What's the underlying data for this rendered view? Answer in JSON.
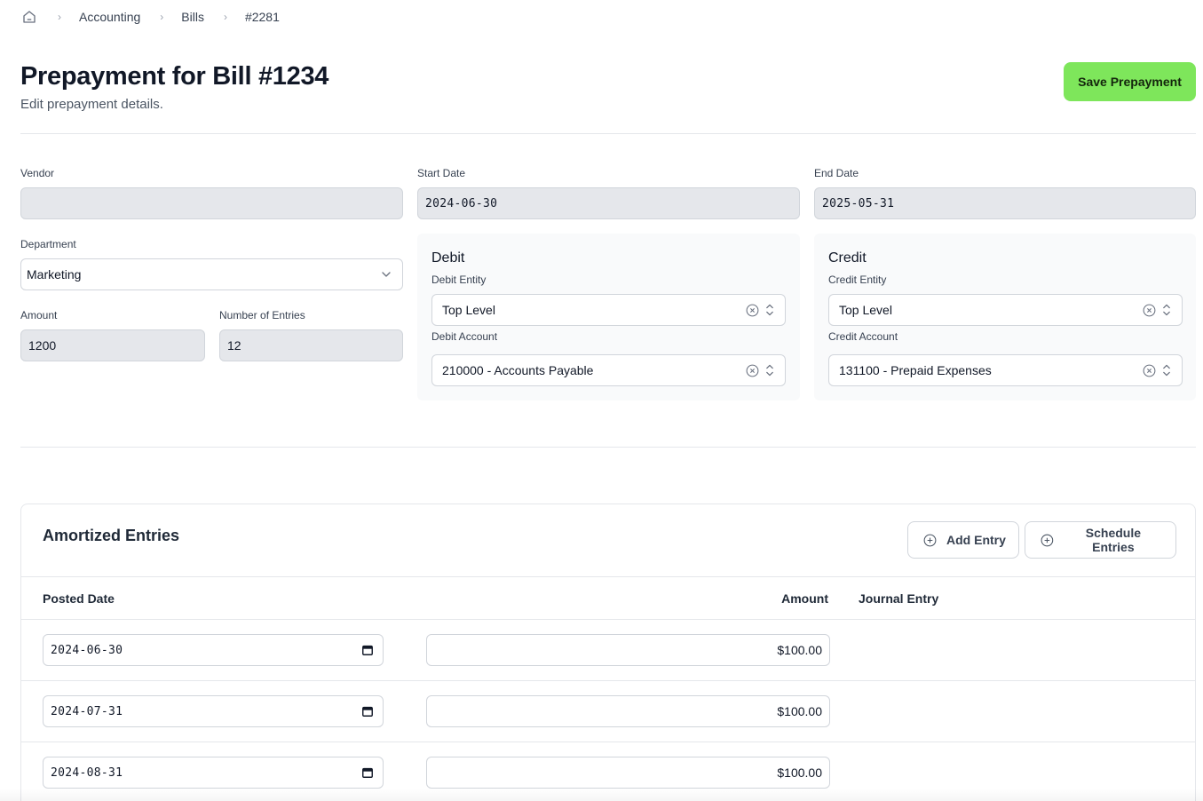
{
  "breadcrumb": {
    "items": [
      "Accounting",
      "Bills",
      "#2281"
    ]
  },
  "header": {
    "title": "Prepayment for Bill #1234",
    "subtitle": "Edit prepayment details.",
    "save_label": "Save Prepayment"
  },
  "form": {
    "vendor": {
      "label": "Vendor",
      "value": ""
    },
    "start_date": {
      "label": "Start Date",
      "value": "2024-06-30"
    },
    "end_date": {
      "label": "End Date",
      "value": "2025-05-31"
    },
    "department": {
      "label": "Department",
      "value": "Marketing"
    },
    "amount": {
      "label": "Amount",
      "value": "1200"
    },
    "number_of_entries": {
      "label": "Number of Entries",
      "value": "12"
    }
  },
  "debit": {
    "title": "Debit",
    "entity_label": "Debit Entity",
    "entity_value": "Top Level",
    "account_label": "Debit Account",
    "account_value": "210000 - Accounts Payable"
  },
  "credit": {
    "title": "Credit",
    "entity_label": "Credit Entity",
    "entity_value": "Top Level",
    "account_label": "Credit Account",
    "account_value": "131100 - Prepaid Expenses"
  },
  "entries": {
    "title": "Amortized Entries",
    "add_label": "Add Entry",
    "schedule_label": "Schedule Entries",
    "columns": {
      "posted_date": "Posted Date",
      "amount": "Amount",
      "journal_entry": "Journal Entry"
    },
    "rows": [
      {
        "date": "2024-06-30",
        "amount": "$100.00"
      },
      {
        "date": "2024-07-31",
        "amount": "$100.00"
      },
      {
        "date": "2024-08-31",
        "amount": "$100.00"
      }
    ]
  },
  "colors": {
    "accent": "#7ee65b",
    "field_bg": "#e5e7eb",
    "panel_bg": "#f9fafb",
    "border": "#d1d5db"
  }
}
